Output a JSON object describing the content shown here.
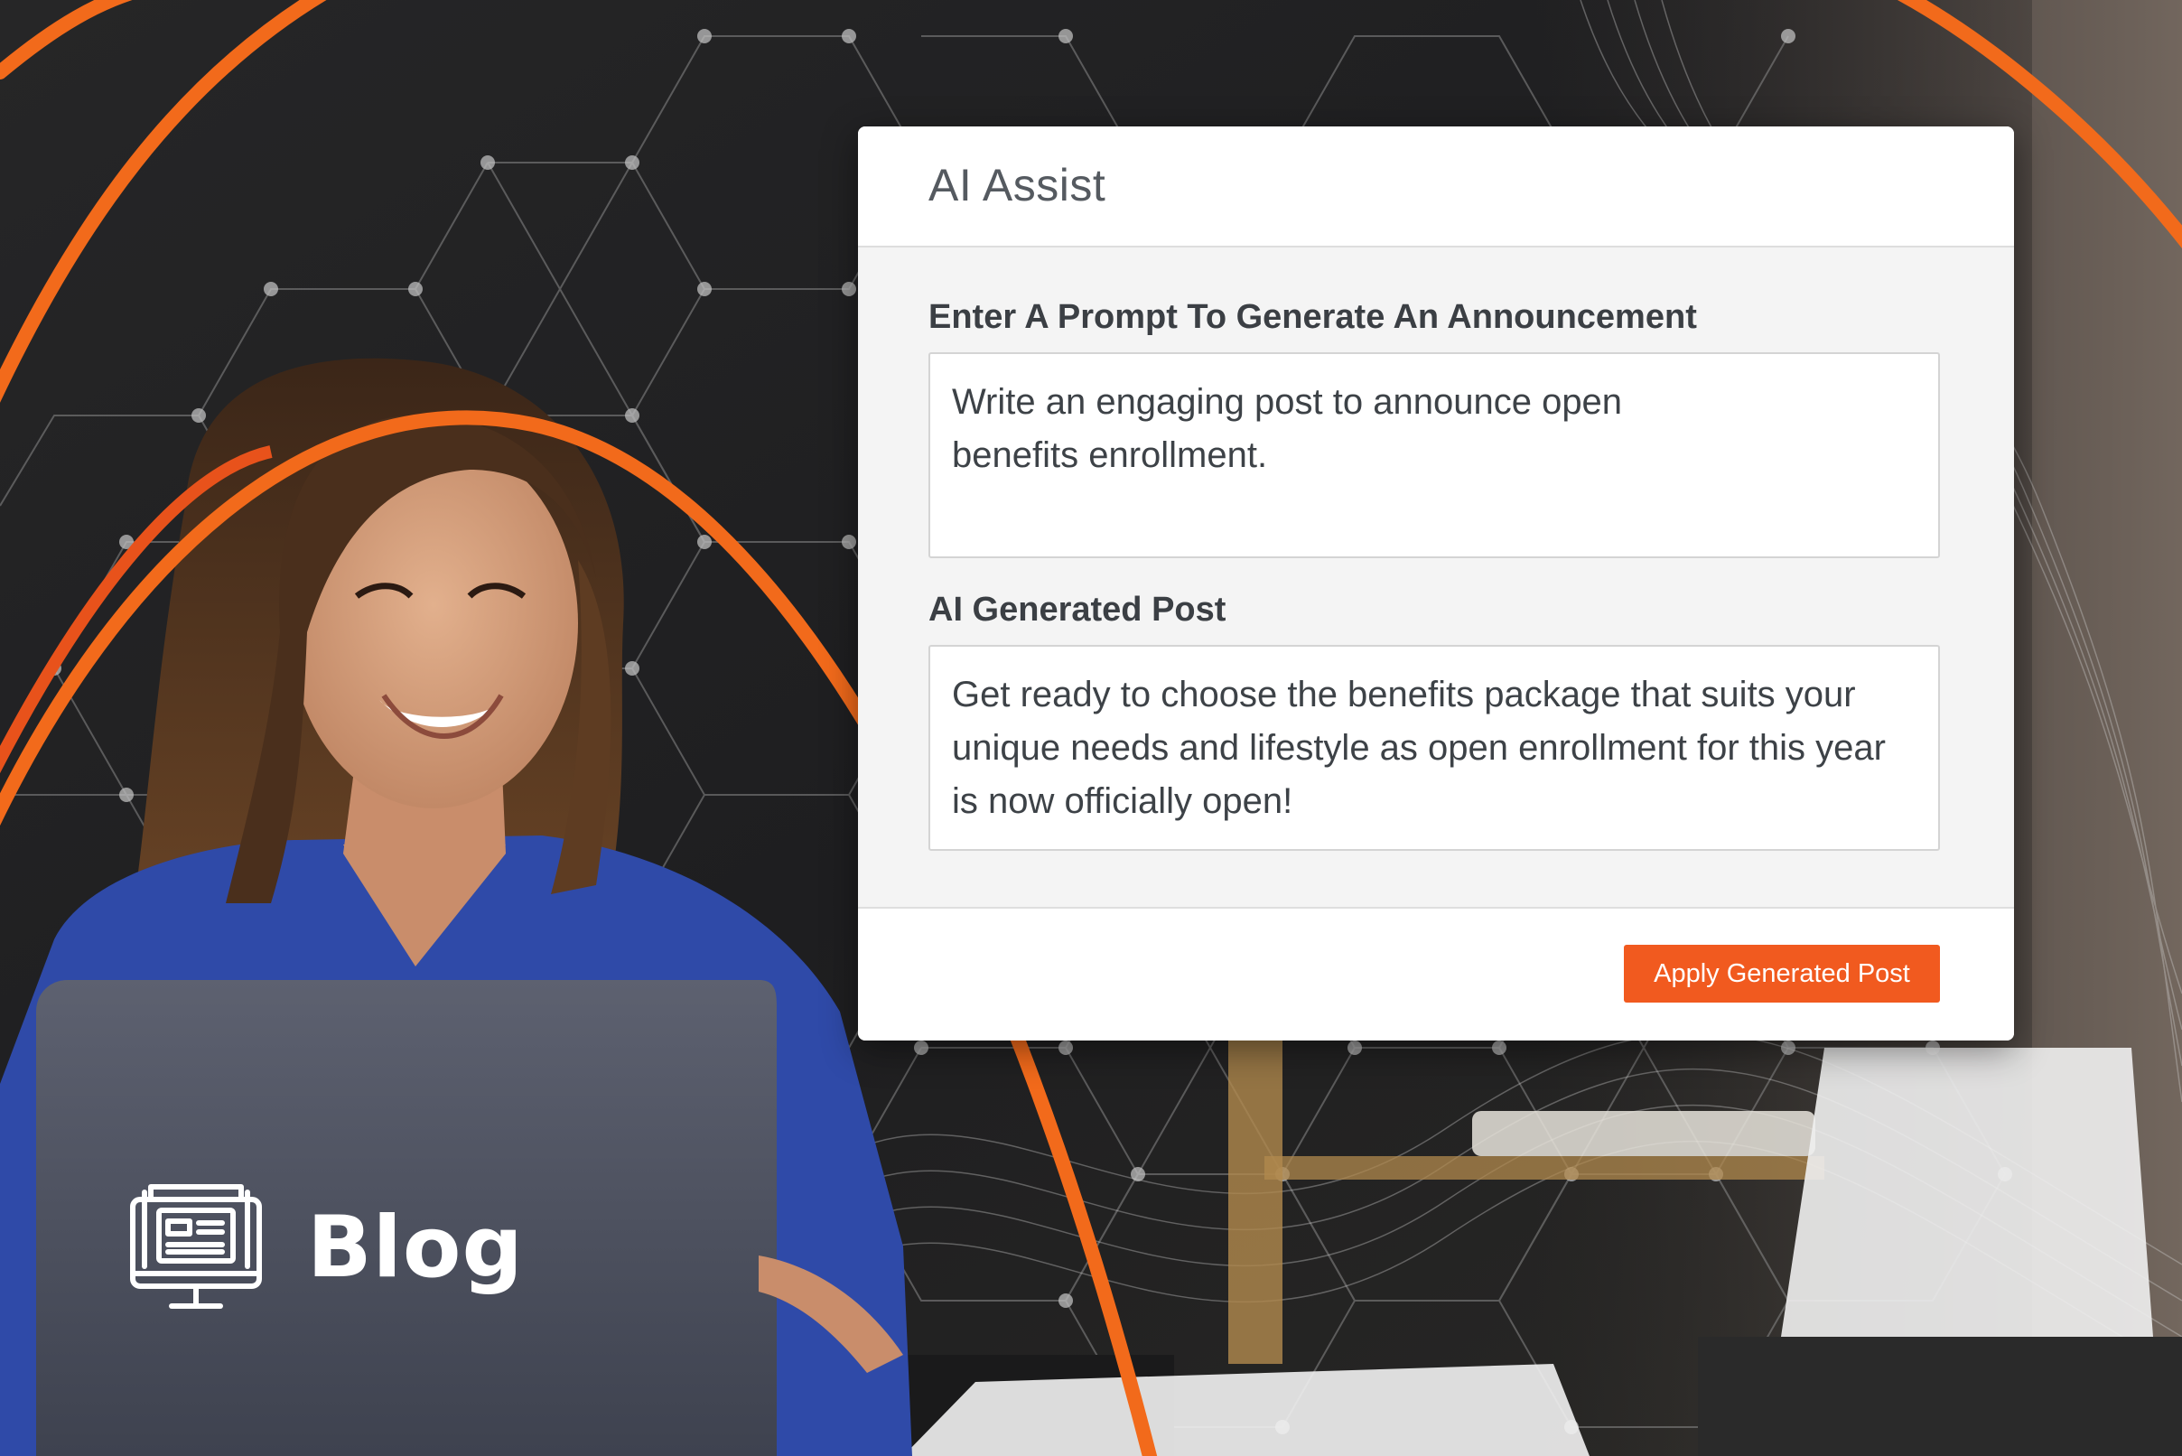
{
  "modal": {
    "title": "AI Assist",
    "prompt_label": "Enter A Prompt To Generate An Announcement",
    "prompt_value": "Write an engaging post to announce open benefits enrollment.",
    "generated_label": "AI Generated Post",
    "generated_value": "Get ready to choose the benefits package that suits your unique needs and lifestyle as open enrollment for this year is now officially open!",
    "apply_button_label": "Apply Generated Post"
  },
  "badge": {
    "label": "Blog",
    "icon": "monitor-article-icon"
  },
  "colors": {
    "accent": "#f15a1f",
    "arc": "#f26a1b",
    "background": "#1c1c1e",
    "person_shirt": "#2f4aa8"
  }
}
